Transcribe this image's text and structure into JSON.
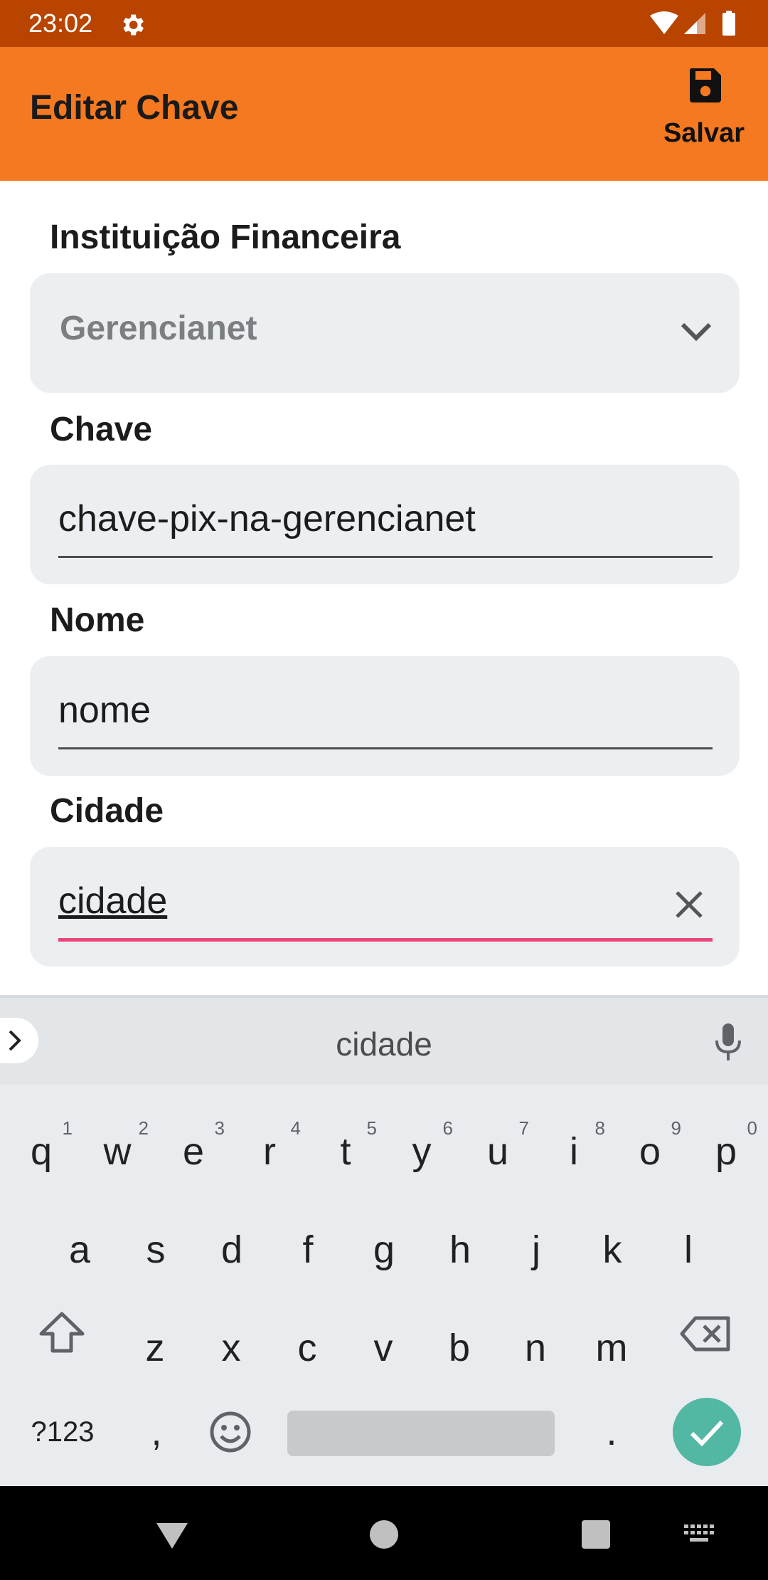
{
  "status_bar": {
    "time": "23:02"
  },
  "app_bar": {
    "title": "Editar Chave",
    "save_label": "Salvar"
  },
  "form": {
    "institution": {
      "label": "Instituição Financeira",
      "value": "Gerencianet"
    },
    "key": {
      "label": "Chave",
      "value": "chave-pix-na-gerencianet"
    },
    "name": {
      "label": "Nome",
      "value": "nome"
    },
    "city": {
      "label": "Cidade",
      "value": "cidade"
    }
  },
  "keyboard": {
    "suggestion": "cidade",
    "row1": [
      "q",
      "w",
      "e",
      "r",
      "t",
      "y",
      "u",
      "i",
      "o",
      "p"
    ],
    "row1_hints": [
      "1",
      "2",
      "3",
      "4",
      "5",
      "6",
      "7",
      "8",
      "9",
      "0"
    ],
    "row2": [
      "a",
      "s",
      "d",
      "f",
      "g",
      "h",
      "j",
      "k",
      "l"
    ],
    "row3": [
      "z",
      "x",
      "c",
      "v",
      "b",
      "n",
      "m"
    ],
    "symbols_label": "?123",
    "comma": ",",
    "period": "."
  },
  "colors": {
    "status_bar": "#b84400",
    "app_bar": "#f47920",
    "focus_underline": "#e8457a",
    "enter_key": "#52b7a3"
  }
}
